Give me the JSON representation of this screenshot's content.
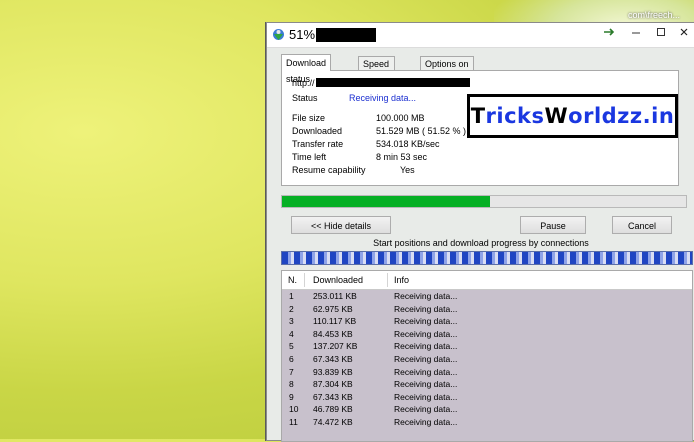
{
  "desktop": {
    "label": "com\\freech..."
  },
  "window": {
    "title": "51%",
    "tabs": [
      {
        "label": "Download status",
        "active": true
      },
      {
        "label": "Speed Limiter",
        "active": false
      },
      {
        "label": "Options on completion",
        "active": false
      }
    ],
    "url_prefix": "http://",
    "status_label": "Status",
    "status_value": "Receiving data...",
    "fields": [
      {
        "label": "File size",
        "value": "100.000  MB"
      },
      {
        "label": "Downloaded",
        "value": "51.529  MB  ( 51.52 % )"
      },
      {
        "label": "Transfer rate",
        "value": "534.018  KB/sec"
      },
      {
        "label": "Time left",
        "value": "8 min 53 sec"
      },
      {
        "label": "Resume capability",
        "value": "Yes"
      }
    ],
    "progress_fraction": 0.515,
    "buttons": {
      "hide_details": "<< Hide details",
      "pause": "Pause",
      "cancel": "Cancel"
    },
    "connections_caption": "Start positions and download progress by connections",
    "table": {
      "headers": [
        "N.",
        "Downloaded",
        "Info"
      ],
      "rows": [
        [
          "1",
          "253.011  KB",
          "Receiving data..."
        ],
        [
          "2",
          "62.975  KB",
          "Receiving data..."
        ],
        [
          "3",
          "110.117  KB",
          "Receiving data..."
        ],
        [
          "4",
          "84.453  KB",
          "Receiving data..."
        ],
        [
          "5",
          "137.207  KB",
          "Receiving data..."
        ],
        [
          "6",
          "67.343  KB",
          "Receiving data..."
        ],
        [
          "7",
          "93.839  KB",
          "Receiving data..."
        ],
        [
          "8",
          "87.304  KB",
          "Receiving data..."
        ],
        [
          "9",
          "67.343  KB",
          "Receiving data..."
        ],
        [
          "10",
          "46.789  KB",
          "Receiving data..."
        ],
        [
          "11",
          "74.472  KB",
          "Receiving data..."
        ]
      ]
    }
  },
  "watermark": {
    "parts": [
      {
        "text": "T",
        "color": "#000000"
      },
      {
        "text": "ricks",
        "color": "#1a37e0"
      },
      {
        "text": "W",
        "color": "#000000"
      },
      {
        "text": "orldzz",
        "color": "#1a37e0"
      },
      {
        "text": ".in",
        "color": "#1a37e0"
      }
    ]
  },
  "colors": {
    "progress": "#06b025",
    "status_text": "#1b2fd0"
  }
}
